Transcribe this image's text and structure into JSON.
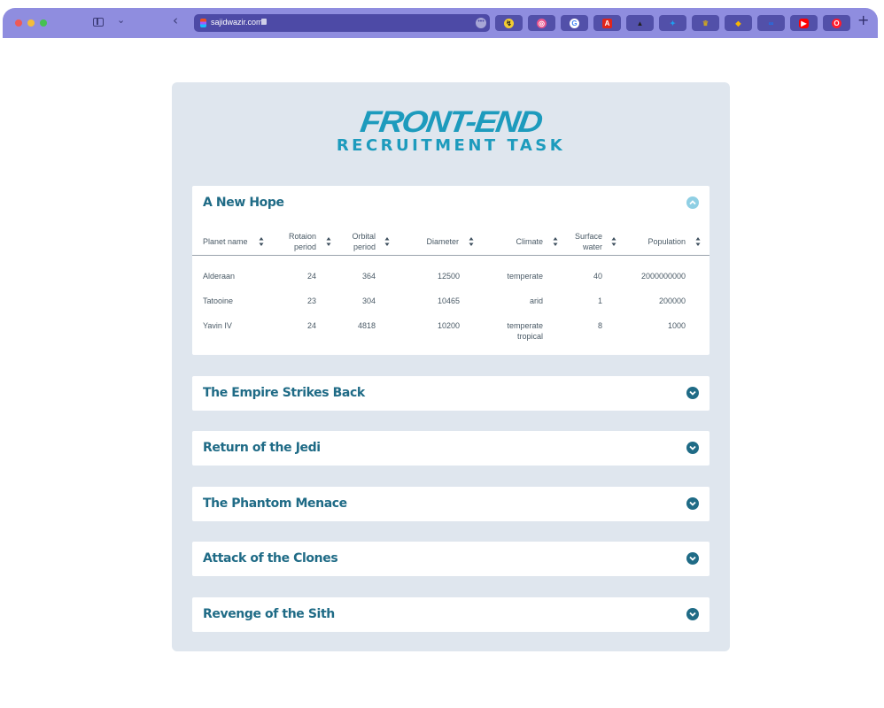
{
  "browser": {
    "url": "sajidwazir.com",
    "new_tab_label": "+",
    "bookmarks": [
      {
        "icon": "klarna-icon",
        "color": "#f3cd31"
      },
      {
        "icon": "dribbble-icon",
        "color": "#e9558e"
      },
      {
        "icon": "google-icon",
        "color": "#4285f4"
      },
      {
        "icon": "adobe-icon",
        "color": "#e1251b"
      },
      {
        "icon": "mountain-icon",
        "color": "#222222"
      },
      {
        "icon": "twitter-icon",
        "color": "#1da1f2"
      },
      {
        "icon": "trophy-icon",
        "color": "#c9a227"
      },
      {
        "icon": "sketch-icon",
        "color": "#f7b500"
      },
      {
        "icon": "meta-icon",
        "color": "#1877f2"
      },
      {
        "icon": "youtube-icon",
        "color": "#ff0000"
      },
      {
        "icon": "opera-icon",
        "color": "#ff1b2d"
      }
    ]
  },
  "header": {
    "logo_main": "FRONT-END",
    "logo_sub": "RECRUITMENT TASK"
  },
  "films": [
    {
      "title": "A New Hope",
      "expanded": true
    },
    {
      "title": "The Empire Strikes Back",
      "expanded": false
    },
    {
      "title": "Return of the Jedi",
      "expanded": false
    },
    {
      "title": "The Phantom Menace",
      "expanded": false
    },
    {
      "title": "Attack of the Clones",
      "expanded": false
    },
    {
      "title": "Revenge of the Sith",
      "expanded": false
    }
  ],
  "table": {
    "columns": [
      {
        "line1": "Planet name",
        "line2": ""
      },
      {
        "line1": "Rotaion",
        "line2": "period"
      },
      {
        "line1": "Orbital",
        "line2": "period"
      },
      {
        "line1": "Diameter",
        "line2": ""
      },
      {
        "line1": "Climate",
        "line2": ""
      },
      {
        "line1": "Surface",
        "line2": "water"
      },
      {
        "line1": "Population",
        "line2": ""
      }
    ],
    "rows": [
      {
        "name": "Alderaan",
        "rotation": "24",
        "orbital": "364",
        "diameter": "12500",
        "climate": "temperate",
        "climate2": "",
        "water": "40",
        "population": "2000000000"
      },
      {
        "name": "Tatooine",
        "rotation": "23",
        "orbital": "304",
        "diameter": "10465",
        "climate": "arid",
        "climate2": "",
        "water": "1",
        "population": "200000"
      },
      {
        "name": "Yavin IV",
        "rotation": "24",
        "orbital": "4818",
        "diameter": "10200",
        "climate": "temperate",
        "climate2": "tropical",
        "water": "8",
        "population": "1000"
      }
    ]
  },
  "colors": {
    "accent": "#1d9bbd",
    "title": "#1f6b86",
    "panel_bg": "#dfe6ee",
    "chrome": "#8f8ddf"
  }
}
